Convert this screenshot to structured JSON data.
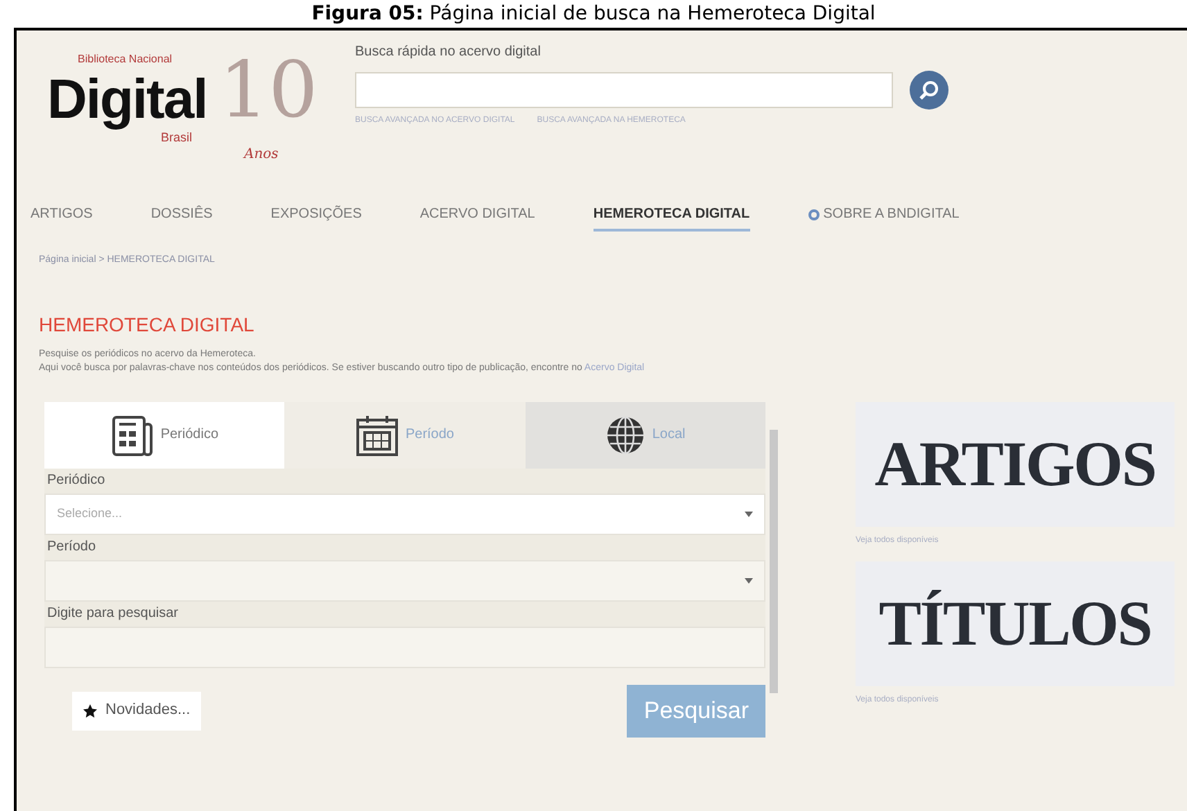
{
  "caption": {
    "label": "Figura 05:",
    "text": "Página inicial de busca na Hemeroteca Digital"
  },
  "logo": {
    "word": "Digital",
    "top": "Biblioteca Nacional",
    "country": "Brasil",
    "number": "10",
    "years": "Anos"
  },
  "quick_search": {
    "label": "Busca rápida no acervo digital",
    "links": [
      "BUSCA AVANÇADA NO ACERVO DIGITAL",
      "BUSCA AVANÇADA NA HEMEROTECA"
    ]
  },
  "nav": [
    {
      "label": "ARTIGOS",
      "selected": false
    },
    {
      "label": "DOSSIÊS",
      "selected": false
    },
    {
      "label": "EXPOSIÇÕES",
      "selected": false
    },
    {
      "label": "ACERVO DIGITAL",
      "selected": false
    },
    {
      "label": "HEMEROTECA DIGITAL",
      "selected": true
    },
    {
      "label": "SOBRE A BNDIGITAL",
      "selected": false
    }
  ],
  "breadcrumb": {
    "home": "Página inicial",
    "current": "> HEMEROTECA DIGITAL"
  },
  "page_title": "HEMEROTECA DIGITAL",
  "intro": [
    "Pesquise os periódicos no acervo da Hemeroteca."
  ],
  "intro_line": {
    "text": "Aqui você busca por palavras-chave nos conteúdos dos periódicos. Se estiver buscando outro tipo de publicação, encontre no",
    "link": "Acervo Digital"
  },
  "search_tabs": [
    {
      "label": "Periódico",
      "kind": "newspaper",
      "selected": true
    },
    {
      "label": "Período",
      "kind": "calendar",
      "selected": false
    },
    {
      "label": "Local",
      "kind": "globe",
      "selected": false
    }
  ],
  "fields": [
    {
      "label": "Periódico",
      "placeholder": "Selecione...",
      "kind": "select"
    },
    {
      "label": "Período",
      "kind": "select"
    },
    {
      "label": "Digite para pesquisar",
      "kind": "text"
    }
  ],
  "news_button": "Novidades...",
  "search_button": "Pesquisar",
  "promos": [
    {
      "title": "ARTIGOS",
      "link": "Veja todos disponíveis"
    },
    {
      "title": "TÍTULOS",
      "link": "Veja todos disponíveis"
    }
  ]
}
